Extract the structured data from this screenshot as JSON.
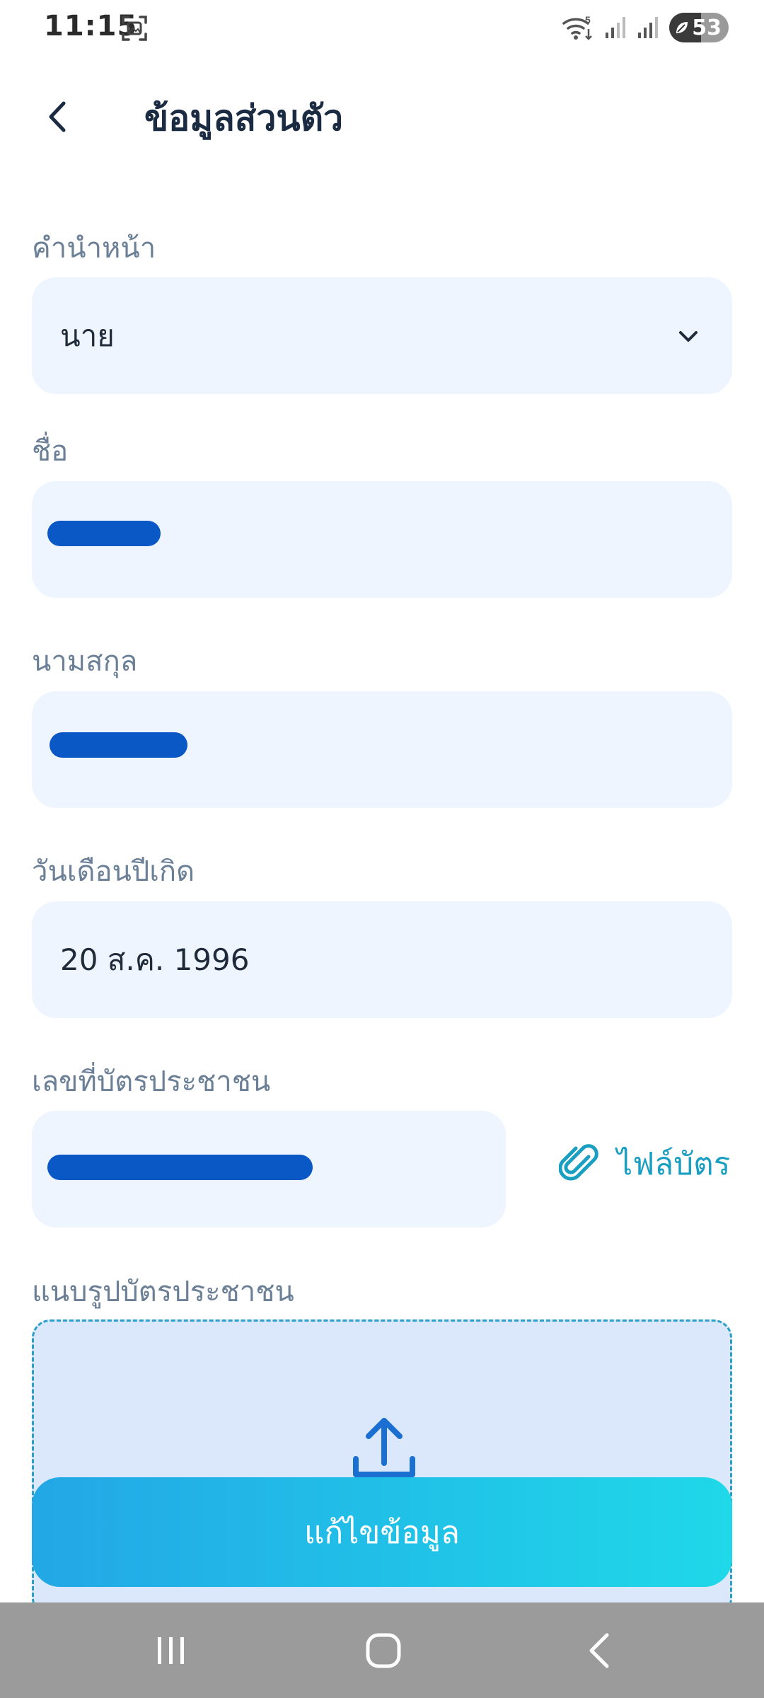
{
  "status_bar": {
    "time": "11:15",
    "battery": "53",
    "wifi_label": "5"
  },
  "header": {
    "title": "ข้อมูลส่วนตัว"
  },
  "form": {
    "prefix": {
      "label": "คำนำหน้า",
      "value": "นาย"
    },
    "first_name": {
      "label": "ชื่อ",
      "value": ""
    },
    "last_name": {
      "label": "นามสกุล",
      "value": ""
    },
    "birth_date": {
      "label": "วันเดือนปีเกิด",
      "value": "20 ส.ค. 1996"
    },
    "id_number": {
      "label": "เลขที่บัตรประชาชน",
      "value": ""
    },
    "attach_file_label": "ไฟล์บัตร",
    "upload": {
      "label": "แนบรูปบัตรประชาชน"
    }
  },
  "actions": {
    "edit_label": "แก้ไขข้อมูล"
  },
  "colors": {
    "field_bg": "#eef5fe",
    "accent": "#1a9ec2",
    "button_gradient_start": "#23a7e6",
    "button_gradient_end": "#1fd8e8",
    "redaction": "#0a57c6"
  },
  "icons": {
    "back": "chevron-left-icon",
    "dropdown": "chevron-down-icon",
    "attach": "paperclip-icon",
    "upload": "upload-icon"
  }
}
